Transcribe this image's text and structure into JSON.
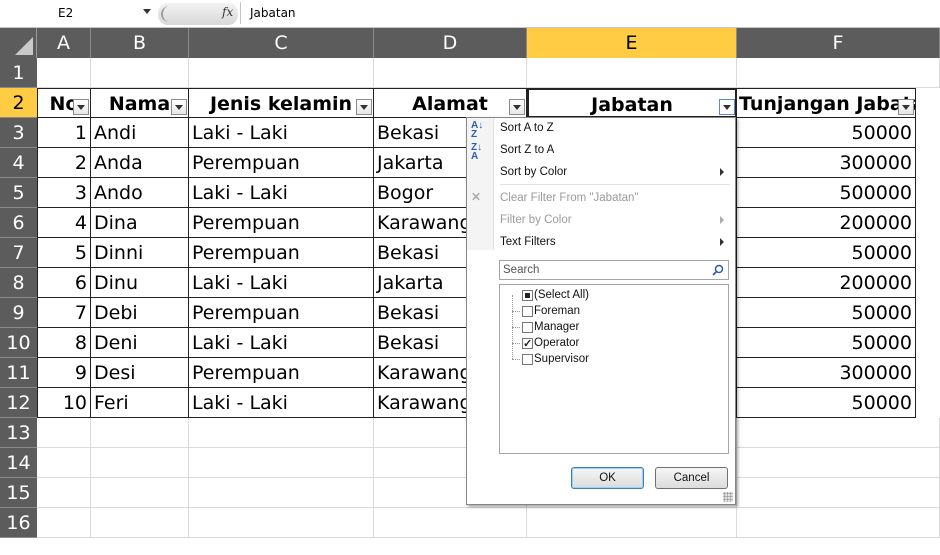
{
  "name_box": "E2",
  "fx": "fx",
  "formula_value": "Jabatan",
  "columns": [
    "A",
    "B",
    "C",
    "D",
    "E",
    "F"
  ],
  "rows": [
    "1",
    "2",
    "3",
    "4",
    "5",
    "6",
    "7",
    "8",
    "9",
    "10",
    "11",
    "12",
    "13",
    "14",
    "15",
    "16"
  ],
  "headers": {
    "no": "No",
    "nama": "Nama",
    "jenis": "Jenis kelamin",
    "alamat": "Alamat",
    "jabatan": "Jabatan",
    "tunjangan": "Tunjangan Jabatan"
  },
  "data": [
    {
      "no": "1",
      "nama": "Andi",
      "jenis": "Laki - Laki",
      "alamat": "Bekasi",
      "tunj": "50000"
    },
    {
      "no": "2",
      "nama": "Anda",
      "jenis": "Perempuan",
      "alamat": "Jakarta",
      "tunj": "300000"
    },
    {
      "no": "3",
      "nama": "Ando",
      "jenis": "Laki - Laki",
      "alamat": "Bogor",
      "tunj": "500000"
    },
    {
      "no": "4",
      "nama": "Dina",
      "jenis": "Perempuan",
      "alamat": "Karawang",
      "tunj": "200000"
    },
    {
      "no": "5",
      "nama": "Dinni",
      "jenis": "Perempuan",
      "alamat": "Bekasi",
      "tunj": "50000"
    },
    {
      "no": "6",
      "nama": "Dinu",
      "jenis": "Laki - Laki",
      "alamat": "Jakarta",
      "tunj": "200000"
    },
    {
      "no": "7",
      "nama": "Debi",
      "jenis": "Perempuan",
      "alamat": "Bekasi",
      "tunj": "50000"
    },
    {
      "no": "8",
      "nama": "Deni",
      "jenis": "Laki - Laki",
      "alamat": "Bekasi",
      "tunj": "50000"
    },
    {
      "no": "9",
      "nama": "Desi",
      "jenis": "Perempuan",
      "alamat": "Karawang",
      "tunj": "300000"
    },
    {
      "no": "10",
      "nama": "Feri",
      "jenis": "Laki - Laki",
      "alamat": "Karawang",
      "tunj": "50000"
    }
  ],
  "filter_menu": {
    "sort_az": "Sort A to Z",
    "sort_za": "Sort Z to A",
    "sort_color": "Sort by Color",
    "clear_filter": "Clear Filter From \"Jabatan\"",
    "filter_color": "Filter by Color",
    "text_filters": "Text Filters",
    "search_placeholder": "Search",
    "items": [
      {
        "label": "(Select All)",
        "state": "partial"
      },
      {
        "label": "Foreman",
        "state": "unchecked"
      },
      {
        "label": "Manager",
        "state": "unchecked"
      },
      {
        "label": "Operator",
        "state": "checked"
      },
      {
        "label": "Supervisor",
        "state": "unchecked"
      }
    ],
    "ok": "OK",
    "cancel": "Cancel"
  }
}
